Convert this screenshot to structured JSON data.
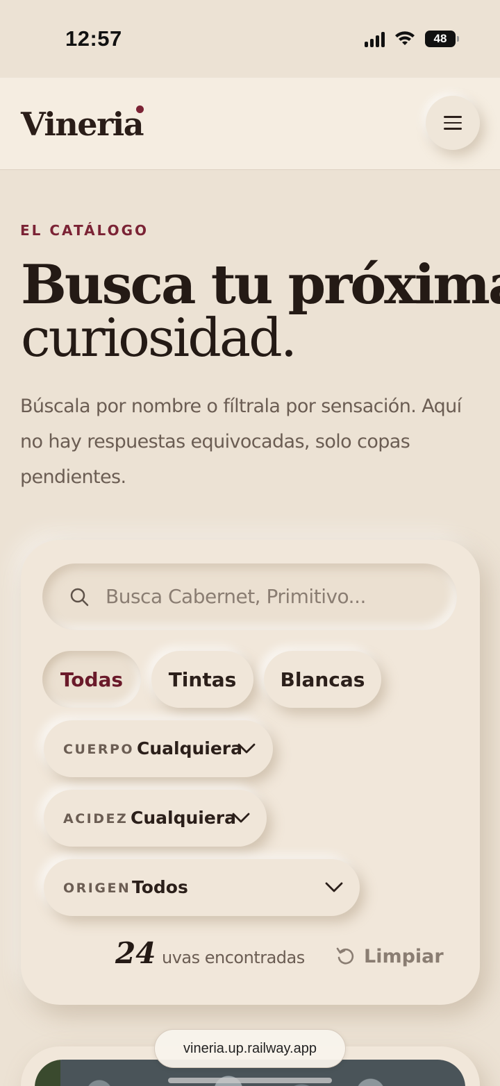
{
  "status_bar": {
    "time": "12:57",
    "battery": "48"
  },
  "header": {
    "logo": "Vineria",
    "menu_icon": "hamburger-icon"
  },
  "hero": {
    "eyebrow": "EL CATÁLOGO",
    "title_line1": "Busca tu próxima",
    "title_line2": "curiosidad.",
    "lede": "Búscala por nombre o fíltrala por sensación. Aquí no hay respuestas equivocadas, solo copas pendientes."
  },
  "filters": {
    "search_placeholder": "Busca Cabernet, Primitivo...",
    "chips": [
      {
        "label": "Todas",
        "active": true
      },
      {
        "label": "Tintas",
        "active": false
      },
      {
        "label": "Blancas",
        "active": false
      }
    ],
    "selects": [
      {
        "label": "CUERPO",
        "value": "Cualquiera"
      },
      {
        "label": "ACIDEZ",
        "value": "Cualquiera"
      },
      {
        "label": "ORIGEN",
        "value": "Todos"
      }
    ],
    "result_count": "24",
    "result_label": "uvas encontradas",
    "clear_label": "Limpiar"
  },
  "browser": {
    "url": "vineria.up.railway.app"
  },
  "colors": {
    "accent": "#7b2335",
    "background": "#ece2d4",
    "text": "#2b1f1a"
  }
}
